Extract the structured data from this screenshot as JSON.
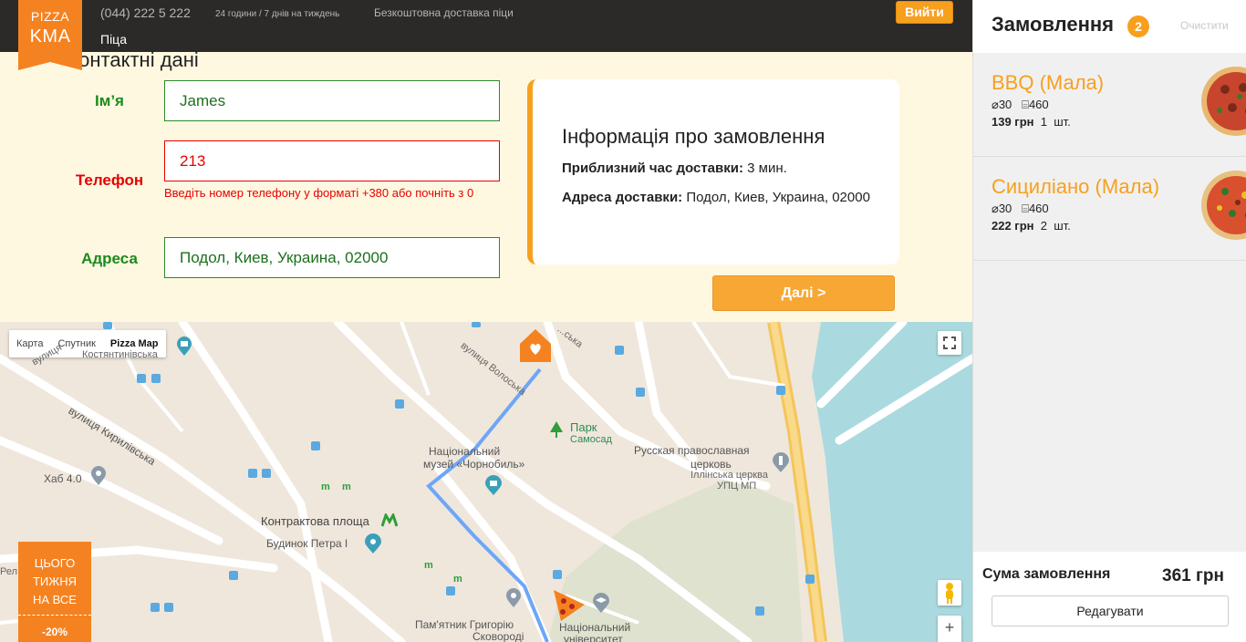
{
  "header": {
    "logo_line1": "PIZZA",
    "logo_line2": "KMA",
    "phone": "(044) 222 5 222",
    "hours": "24 години / 7 днів на тиждень",
    "delivery": "Безкоштовна доставка піци",
    "login_label": "Вийти",
    "nav_pizza": "Піца"
  },
  "form": {
    "section_title": "Контактні дані",
    "name_label": "Ім’я",
    "name_value": "James",
    "phone_label": "Телефон",
    "phone_value": "213",
    "phone_error": "Введіть номер телефону у форматі +380 або почніть з 0",
    "address_label": "Адреса",
    "address_value": "Подол, Киев, Украина, 02000"
  },
  "order_info": {
    "title": "Інформація про замовлення",
    "time_label": "Приблизний час доставки:",
    "time_value": "3 мин.",
    "address_label": "Адреса доставки:",
    "address_value": "Подол, Киев, Украина, 02000",
    "next_label": "Далі >"
  },
  "map": {
    "types": [
      "Карта",
      "Спутник",
      "Pizza Map"
    ],
    "active_type": "Pizza Map",
    "labels": {
      "park": "Парк",
      "park_sub": "Самосад",
      "museum": "Національний",
      "museum2": "музей «Чорнобиль»",
      "church": "Русская православная",
      "church2": "церковь",
      "church3": "Іллінська церква",
      "church4": "УПЦ МП",
      "square": "Контрактова площа",
      "house": "Будинок Петра І",
      "hub": "Хаб 4.0",
      "street1": "вулиця Кирилівська",
      "street2": "вулиця Волоська",
      "monument": "Пам'ятник Григорію",
      "monument2": "Сковороді",
      "uni": "Національний",
      "uni2": "університет",
      "street3": "вулиця",
      "street4": "Костянтинівська",
      "street5": "Рел...",
      "street6": "...ська"
    },
    "fullscreen_icon": "fullscreen-icon",
    "pegman_icon": "pegman-icon",
    "zoom_in_label": "+"
  },
  "promo": {
    "line1": "ЦЬОГО",
    "line2": "ТИЖНЯ",
    "line3": "НА ВСЕ",
    "discount": "-20%"
  },
  "cart": {
    "title": "Замовлення",
    "count": "2",
    "clear_label": "Очистити",
    "items": [
      {
        "name": "BBQ (Мала)",
        "diameter": "30",
        "weight": "460",
        "price": "139 грн",
        "qty": "1",
        "qty_unit": "шт."
      },
      {
        "name": "Сициліано (Мала)",
        "diameter": "30",
        "weight": "460",
        "price": "222 грн",
        "qty": "2",
        "qty_unit": "шт."
      }
    ],
    "sum_label": "Сума замовлення",
    "sum_value": "361 грн",
    "edit_label": "Редагувати"
  },
  "colors": {
    "accent": "#f7a01e",
    "logo": "#f58220",
    "topbar": "#2b2a28",
    "form_bg": "#fff8e0",
    "valid": "#1d8a1d",
    "error": "#e60000",
    "route": "#6ea6f7",
    "water": "#aadadf"
  }
}
